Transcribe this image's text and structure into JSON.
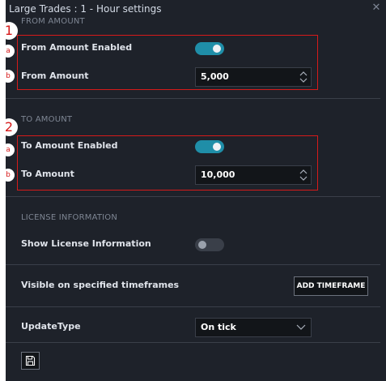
{
  "window": {
    "title": "Large Trades : 1 - Hour settings",
    "close_icon": "close-icon"
  },
  "from_amount": {
    "section_title": "FROM AMOUNT",
    "enabled_label": "From Amount Enabled",
    "enabled": true,
    "amount_label": "From Amount",
    "amount_value": "5,000"
  },
  "to_amount": {
    "section_title": "TO AMOUNT",
    "enabled_label": "To Amount Enabled",
    "enabled": true,
    "amount_label": "To Amount",
    "amount_value": "10,000"
  },
  "license": {
    "section_title": "LICENSE INFORMATION",
    "show_label": "Show License Information",
    "show_enabled": false
  },
  "timeframes": {
    "label": "Visible on specified timeframes",
    "add_button": "ADD TIMEFRAME"
  },
  "update_type": {
    "label": "UpdateType",
    "selected": "On tick"
  },
  "footer": {
    "save_icon": "save-icon"
  },
  "annotations": {
    "group1": "1",
    "group2": "2",
    "a": "a",
    "b": "b"
  },
  "colors": {
    "panel_bg": "#1e222a",
    "toggle_on": "#1f8ea8",
    "annotation_red": "#d61a1a"
  }
}
